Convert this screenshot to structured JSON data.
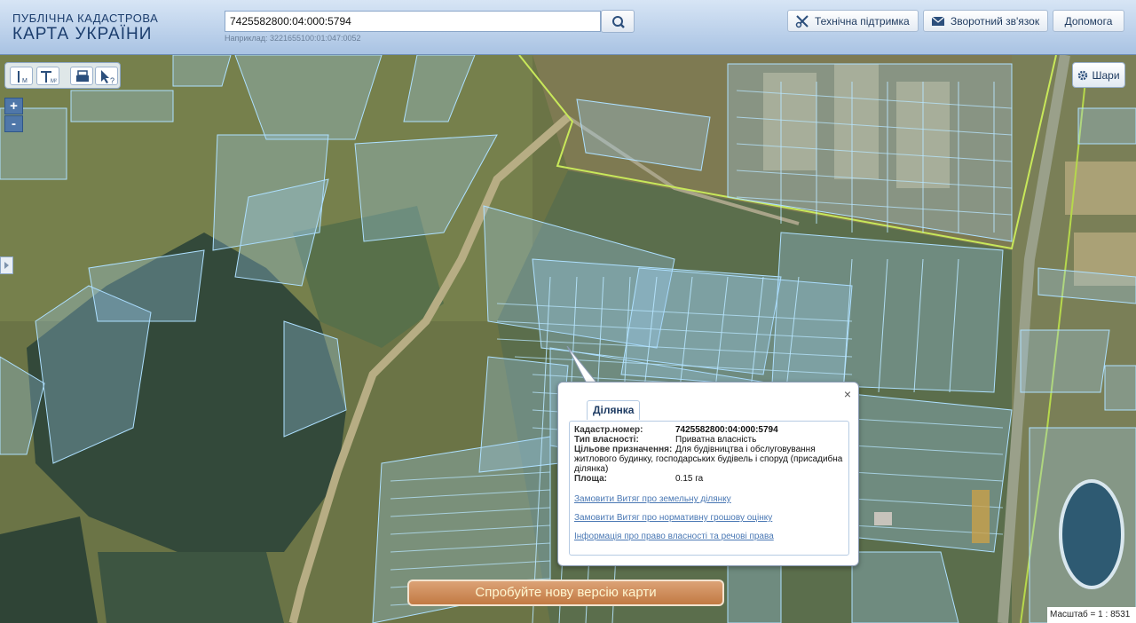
{
  "header": {
    "logo_line1": "ПУБЛІЧНА КАДАСТРОВА",
    "logo_line2": "КАРТА УКРАЇНИ",
    "search_value": "7425582800:04:000:5794",
    "search_hint": "Наприклад: 3221655100:01:047:0052",
    "buttons": {
      "support": "Технічна підтримка",
      "feedback": "Зворотний зв'язок",
      "help": "Допомога"
    }
  },
  "map": {
    "layers_label": "Шари",
    "zoom_in": "+",
    "zoom_out": "-",
    "scale": "Масштаб = 1 : 8531",
    "new_version": "Спробуйте нову версію карти",
    "colors": {
      "parcel": "#9fd0f5",
      "boundary": "#c8e85a",
      "forest": "#2f4a3a"
    }
  },
  "popup": {
    "tab": "Ділянка",
    "close": "×",
    "cadastre_label": "Кадастр.номер:",
    "cadastre_value": "7425582800:04:000:5794",
    "ownership_label": "Тип власності:",
    "ownership_value": "Приватна власність",
    "purpose_label": "Цільове призначення:",
    "purpose_value": "Для будівництва і обслуговування",
    "purpose_rest": "житлового будинку, господарських будівель і споруд (присадибна ділянка)",
    "area_label": "Площа:",
    "area_value": "0.15 га",
    "links": [
      "Замовити Витяг про земельну ділянку",
      "Замовити Витяг про нормативну грошову оцінку",
      "Інформація про право власності та речові права"
    ]
  }
}
